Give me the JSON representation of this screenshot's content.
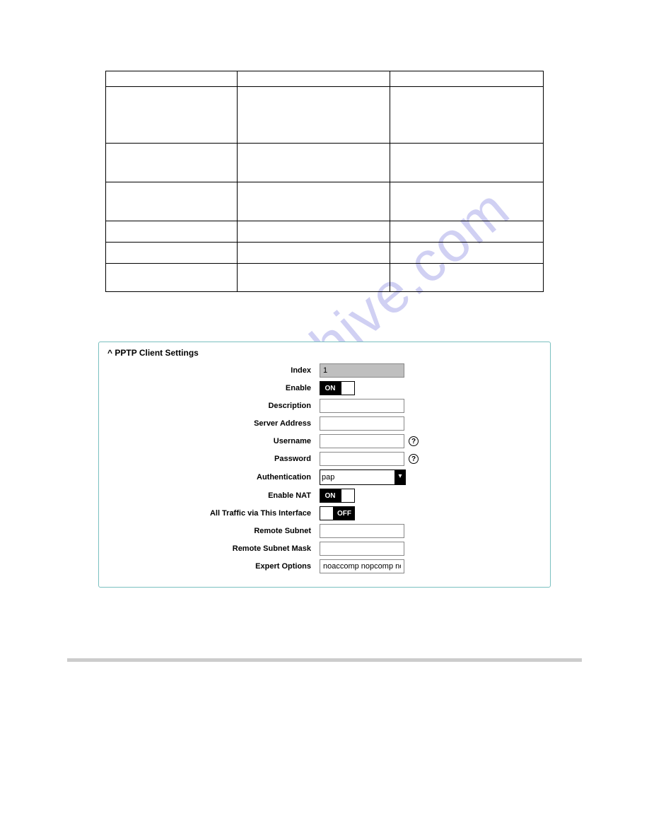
{
  "watermark": "manualshive.com",
  "panel": {
    "title": "PPTP Client Settings",
    "caret": "^",
    "fields": {
      "index_label": "Index",
      "index_value": "1",
      "enable_label": "Enable",
      "enable_value": "true",
      "description_label": "Description",
      "description_value": "",
      "server_label": "Server Address",
      "server_value": "",
      "username_label": "Username",
      "username_value": "",
      "password_label": "Password",
      "password_value": "",
      "auth_label": "Authentication",
      "auth_value": "pap",
      "nat_label": "Enable NAT",
      "nat_value": "true",
      "traffic_label": "All Traffic via This Interface",
      "traffic_value": "false",
      "subnet_label": "Remote Subnet",
      "subnet_value": "",
      "mask_label": "Remote Subnet Mask",
      "mask_value": "",
      "expert_label": "Expert Options",
      "expert_value": "noaccomp nopcomp no"
    },
    "toggle_on_text": "ON",
    "toggle_off_text": "OFF",
    "help_symbol": "?"
  }
}
